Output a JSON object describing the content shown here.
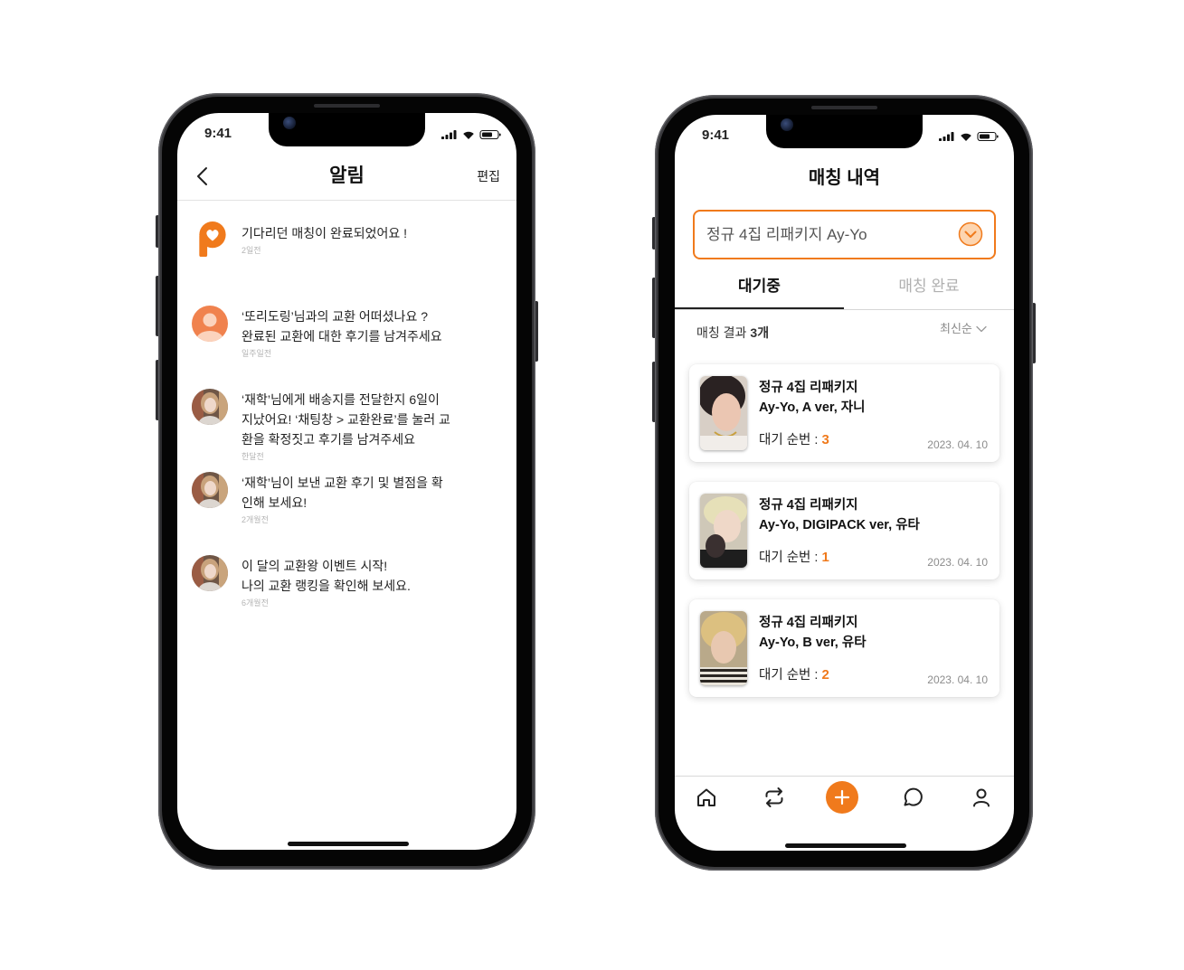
{
  "colors": {
    "accent": "#F07A1C",
    "text": "#222222",
    "muted": "#B4B4B4"
  },
  "notifications_screen": {
    "status_time": "9:41",
    "title": "알림",
    "edit_label": "편집",
    "items": [
      {
        "icon": "app-logo-icon",
        "lines": [
          "기다리던 매칭이 완료되었어요 !"
        ],
        "time": "2일전"
      },
      {
        "icon": "default-avatar",
        "lines": [
          "‘또리도링’님과의 교환 어떠셨나요 ?",
          "완료된 교환에 대한 후기를 남겨주세요"
        ],
        "time": "일주일전"
      },
      {
        "icon": "user-photo-avatar",
        "lines": [
          "‘재학’님에게 배송지를 전달한지 6일이",
          "지났어요! ‘채팅창 > 교환완료’를 눌러 교",
          "환을 확정짓고 후기를 남겨주세요"
        ],
        "time": "한달전"
      },
      {
        "icon": "user-photo-avatar",
        "lines": [
          "‘재학’님이 보낸 교환 후기 및 별점을 확",
          "인해 보세요!"
        ],
        "time": "2개월전"
      },
      {
        "icon": "user-photo-avatar",
        "lines": [
          "이 달의 교환왕 이벤트 시작!",
          "나의 교환 랭킹을 확인해 보세요."
        ],
        "time": "6개월전"
      }
    ]
  },
  "matching_screen": {
    "status_time": "9:41",
    "title": "매칭 내역",
    "album_select": {
      "value": "정규 4집 리패키지 Ay-Yo"
    },
    "tabs": [
      {
        "label": "대기중",
        "active": true
      },
      {
        "label": "매칭 완료",
        "active": false
      }
    ],
    "result_label": "매칭 결과",
    "result_count": "3개",
    "sort_label": "최신순",
    "cards": [
      {
        "title": "정규 4집 리패키지",
        "subtitle": "Ay-Yo, A ver, 자니",
        "queue_label": "대기 순번 :",
        "queue_number": "3",
        "date": "2023. 04. 10"
      },
      {
        "title": "정규 4집 리패키지",
        "subtitle": "Ay-Yo, DIGIPACK ver, 유타",
        "queue_label": "대기 순번 :",
        "queue_number": "1",
        "date": "2023. 04. 10"
      },
      {
        "title": "정규 4집 리패키지",
        "subtitle": "Ay-Yo, B ver, 유타",
        "queue_label": "대기 순번 :",
        "queue_number": "2",
        "date": "2023. 04. 10"
      }
    ],
    "nav": [
      {
        "icon": "home-icon"
      },
      {
        "icon": "exchange-icon"
      },
      {
        "icon": "add-icon"
      },
      {
        "icon": "chat-icon"
      },
      {
        "icon": "profile-icon"
      }
    ]
  }
}
